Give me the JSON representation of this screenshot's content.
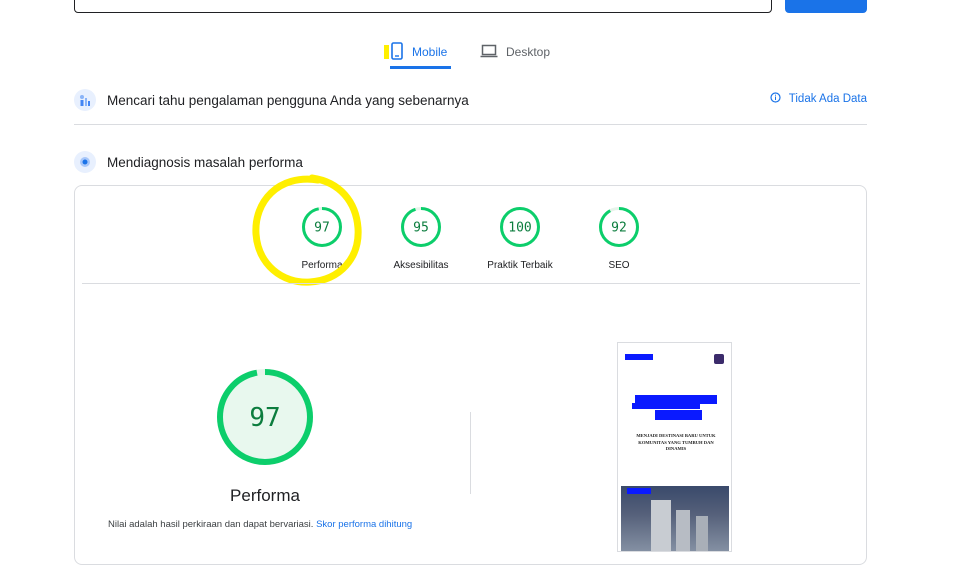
{
  "tabs": [
    {
      "label": "Mobile"
    },
    {
      "label": "Desktop"
    }
  ],
  "field_data_section": {
    "title": "Mencari tahu pengalaman pengguna Anda yang sebenarnya",
    "link": "Tidak Ada Data"
  },
  "diagnose_section": {
    "title": "Mendiagnosis masalah performa"
  },
  "scores": [
    {
      "value": 97,
      "label": "Performa",
      "fraction": 0.97
    },
    {
      "value": 95,
      "label": "Aksesibilitas",
      "fraction": 0.95
    },
    {
      "value": 100,
      "label": "Praktik Terbaik",
      "fraction": 1.0
    },
    {
      "value": 92,
      "label": "SEO",
      "fraction": 0.92
    }
  ],
  "detail": {
    "score": 97,
    "title": "Performa",
    "desc_prefix": "Nilai adalah hasil perkiraan dan dapat bervariasi.",
    "desc_link": "Skor performa dihitung"
  },
  "screenshot": {
    "headline": "MENJADI DESTINASI BARU UNTUK KOMUNITAS YANG TUMBUH DAN DINAMIS"
  },
  "colors": {
    "accent": "#1a73e8",
    "pass_green": "#0cce6b",
    "pass_fill": "#e8f8ee",
    "annotation_yellow": "#ffef00"
  },
  "icons": {
    "mobile_tab": "smartphone-icon",
    "desktop_tab": "laptop-icon",
    "field_data": "users-chart-icon",
    "diagnose": "lab-target-icon",
    "info": "info-icon"
  }
}
